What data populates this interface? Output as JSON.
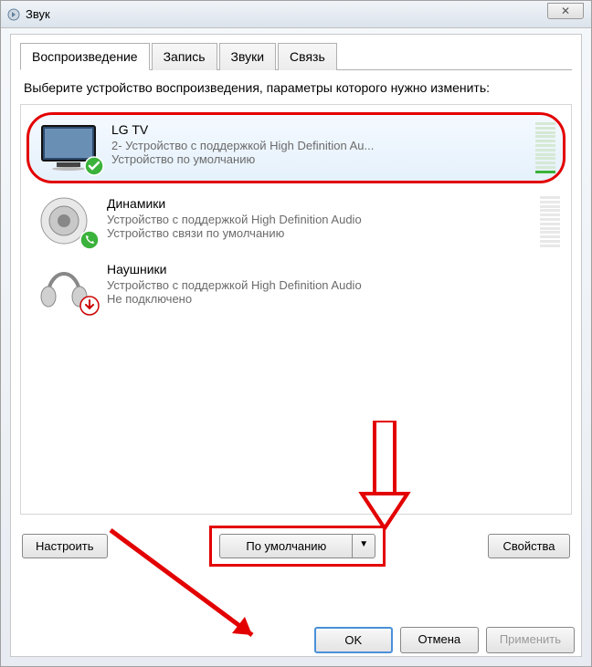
{
  "window": {
    "title": "Звук"
  },
  "tabs": {
    "playback": "Воспроизведение",
    "recording": "Запись",
    "sounds": "Звуки",
    "communications": "Связь"
  },
  "instruction": "Выберите устройство воспроизведения, параметры которого нужно изменить:",
  "devices": [
    {
      "name": "LG TV",
      "description": "2- Устройство с поддержкой High Definition Au...",
      "status": "Устройство по умолчанию",
      "selected": true,
      "badge": "check",
      "meter": "active"
    },
    {
      "name": "Динамики",
      "description": "Устройство с поддержкой High Definition Audio",
      "status": "Устройство связи по умолчанию",
      "selected": false,
      "badge": "phone",
      "meter": "dim"
    },
    {
      "name": "Наушники",
      "description": "Устройство с поддержкой High Definition Audio",
      "status": "Не подключено",
      "selected": false,
      "badge": "down",
      "meter": "none"
    }
  ],
  "buttons": {
    "configure": "Настроить",
    "set_default": "По умолчанию",
    "properties": "Свойства",
    "ok": "OK",
    "cancel": "Отмена",
    "apply": "Применить"
  }
}
